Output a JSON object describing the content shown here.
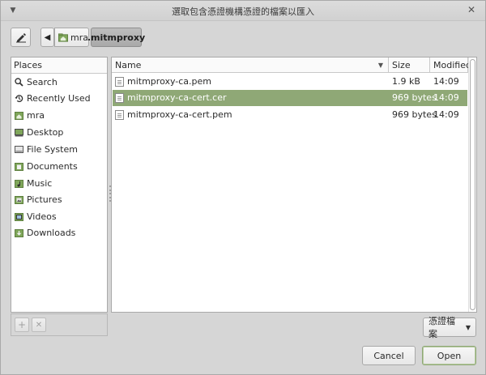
{
  "window": {
    "title": "選取包含憑證機構憑證的檔案以匯入",
    "menu_glyph": "▼",
    "close_glyph": "✕"
  },
  "path_bar": {
    "back_glyph": "◀",
    "crumbs": [
      {
        "label": "mra",
        "icon": "home-folder-icon"
      },
      {
        "label": ".mitmproxy",
        "icon": ""
      }
    ]
  },
  "places": {
    "header": "Places",
    "items": [
      {
        "label": "Search",
        "icon": "search-icon"
      },
      {
        "label": "Recently Used",
        "icon": "recent-icon"
      },
      {
        "label": "mra",
        "icon": "home-folder-icon"
      },
      {
        "label": "Desktop",
        "icon": "desktop-icon"
      },
      {
        "label": "File System",
        "icon": "drive-icon"
      },
      {
        "label": "Documents",
        "icon": "documents-folder-icon"
      },
      {
        "label": "Music",
        "icon": "music-folder-icon"
      },
      {
        "label": "Pictures",
        "icon": "pictures-folder-icon"
      },
      {
        "label": "Videos",
        "icon": "videos-folder-icon"
      },
      {
        "label": "Downloads",
        "icon": "downloads-folder-icon"
      }
    ],
    "add_glyph": "+",
    "remove_glyph": "✕"
  },
  "file_list": {
    "columns": {
      "name": "Name",
      "size": "Size",
      "modified": "Modified"
    },
    "sort_glyph": "▼",
    "rows": [
      {
        "name": "mitmproxy-ca.pem",
        "size": "1.9 kB",
        "modified": "14:09",
        "selected": false
      },
      {
        "name": "mitmproxy-ca-cert.cer",
        "size": "969 bytes",
        "modified": "14:09",
        "selected": true
      },
      {
        "name": "mitmproxy-ca-cert.pem",
        "size": "969 bytes",
        "modified": "14:09",
        "selected": false
      }
    ]
  },
  "filter": {
    "selected": "憑證檔案",
    "caret": "▼"
  },
  "buttons": {
    "cancel": "Cancel",
    "open": "Open"
  },
  "colors": {
    "selection": "#8fa876",
    "folder_green": "#7fa65a",
    "window_bg": "#d6d6d6"
  }
}
